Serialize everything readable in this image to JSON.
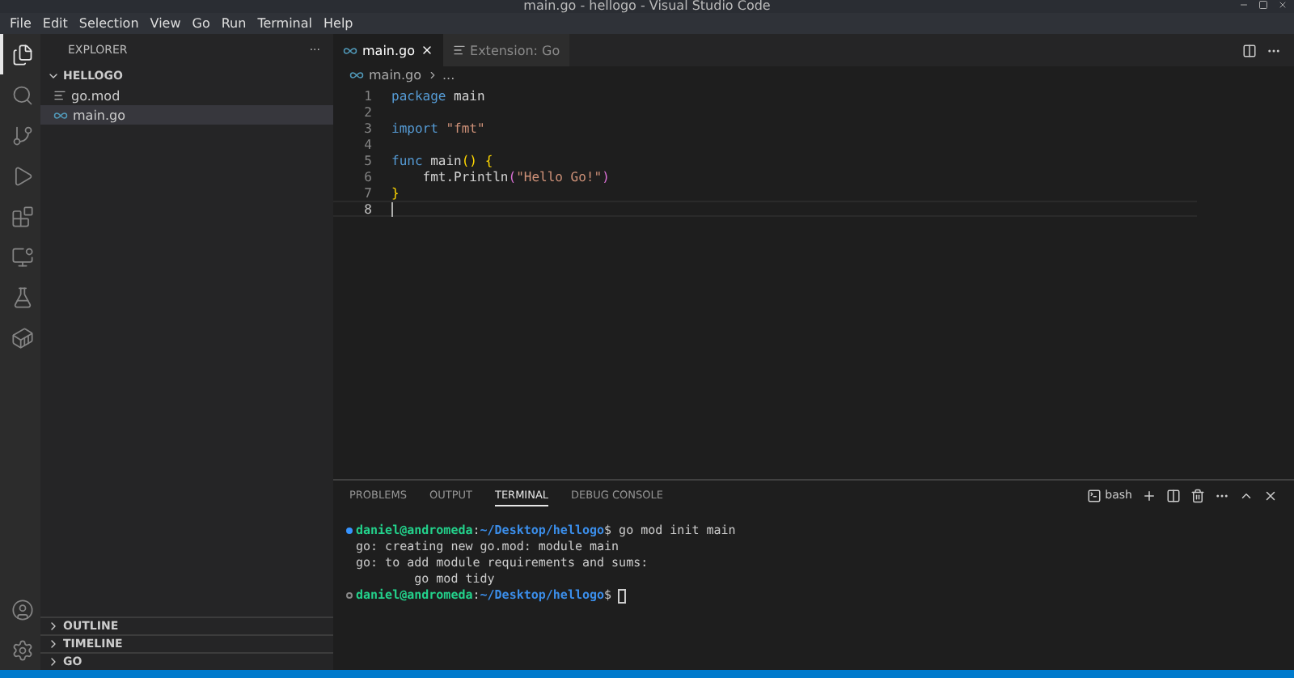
{
  "window": {
    "title": "main.go - hellogo - Visual Studio Code"
  },
  "menu": [
    "File",
    "Edit",
    "Selection",
    "View",
    "Go",
    "Run",
    "Terminal",
    "Help"
  ],
  "activity_bar": [
    {
      "kind": "files",
      "selected": true
    },
    {
      "kind": "search",
      "selected": false
    },
    {
      "kind": "source-control",
      "selected": false
    },
    {
      "kind": "run",
      "selected": false
    },
    {
      "kind": "extensions",
      "selected": false
    },
    {
      "kind": "remote",
      "selected": false
    },
    {
      "kind": "testing",
      "selected": false
    },
    {
      "kind": "docker",
      "selected": false
    }
  ],
  "sidebar": {
    "title": "EXPLORER",
    "more": "···",
    "folder": {
      "name": "HELLOGO",
      "expanded": true,
      "children": [
        {
          "name": "go.mod",
          "kind": "text",
          "selected": false
        },
        {
          "name": "main.go",
          "kind": "go",
          "selected": true
        }
      ]
    },
    "sections": [
      {
        "name": "OUTLINE",
        "expanded": false
      },
      {
        "name": "TIMELINE",
        "expanded": false
      },
      {
        "name": "GO",
        "expanded": false
      }
    ]
  },
  "tabs": [
    {
      "label": "main.go",
      "kind": "go",
      "selected": true
    },
    {
      "label": "Extension: Go",
      "kind": "text",
      "selected": false
    }
  ],
  "breadcrumb": [
    "main.go",
    "..."
  ],
  "editor": {
    "lines": [
      {
        "number": "1",
        "current": false,
        "tokens": [
          {
            "kind": "keyword",
            "text": "package"
          },
          {
            "kind": "plain",
            "text": " main"
          }
        ]
      },
      {
        "number": "2",
        "current": false
      },
      {
        "number": "3",
        "current": false,
        "tokens": [
          {
            "kind": "keyword",
            "text": "import"
          },
          {
            "kind": "string",
            "text": " \"fmt\""
          }
        ]
      },
      {
        "number": "4",
        "current": false
      },
      {
        "number": "5",
        "current": false,
        "tokens": [
          {
            "kind": "keyword",
            "text": "func"
          },
          {
            "kind": "plain",
            "text": " main"
          },
          {
            "kind": "bracket",
            "text": "()"
          },
          {
            "kind": "bracket",
            "text": " {"
          }
        ]
      },
      {
        "number": "6",
        "current": false,
        "tokens": [
          {
            "kind": "plain",
            "text": "    fmt.Println"
          },
          {
            "kind": "bracket2",
            "text": "("
          },
          {
            "kind": "string",
            "text": "\"Hello Go!\""
          },
          {
            "kind": "bracket2",
            "text": ")"
          }
        ]
      },
      {
        "number": "7",
        "current": false,
        "tokens": [
          {
            "kind": "bracket",
            "text": "}"
          }
        ]
      },
      {
        "number": "8",
        "current": true
      }
    ]
  },
  "panel": {
    "tabs": [
      {
        "label": "PROBLEMS",
        "selected": false
      },
      {
        "label": "OUTPUT",
        "selected": false
      },
      {
        "label": "TERMINAL",
        "selected": true
      },
      {
        "label": "DEBUG CONSOLE",
        "selected": false
      }
    ],
    "shell": "bash",
    "terminal": [
      {
        "kind": "prompt",
        "finished": true,
        "segments": [
          {
            "kind": "user",
            "text": "daniel@andromeda"
          },
          {
            "kind": "plain",
            "text": ":"
          },
          {
            "kind": "path",
            "text": "~/Desktop/hellogo"
          },
          {
            "kind": "plain",
            "text": "$ go mod init main"
          }
        ]
      },
      {
        "kind": "output",
        "segments": [
          {
            "kind": "plain",
            "text": "go: creating new go.mod: module main"
          }
        ]
      },
      {
        "kind": "output",
        "segments": [
          {
            "kind": "plain",
            "text": "go: to add module requirements and sums:"
          }
        ]
      },
      {
        "kind": "output",
        "segments": [
          {
            "kind": "plain",
            "text": "        go mod tidy"
          }
        ]
      },
      {
        "kind": "prompt",
        "finished": false,
        "cursor": true,
        "segments": [
          {
            "kind": "user",
            "text": "daniel@andromeda"
          },
          {
            "kind": "plain",
            "text": ":"
          },
          {
            "kind": "path",
            "text": "~/Desktop/hellogo"
          },
          {
            "kind": "plain",
            "text": "$"
          }
        ]
      }
    ]
  }
}
